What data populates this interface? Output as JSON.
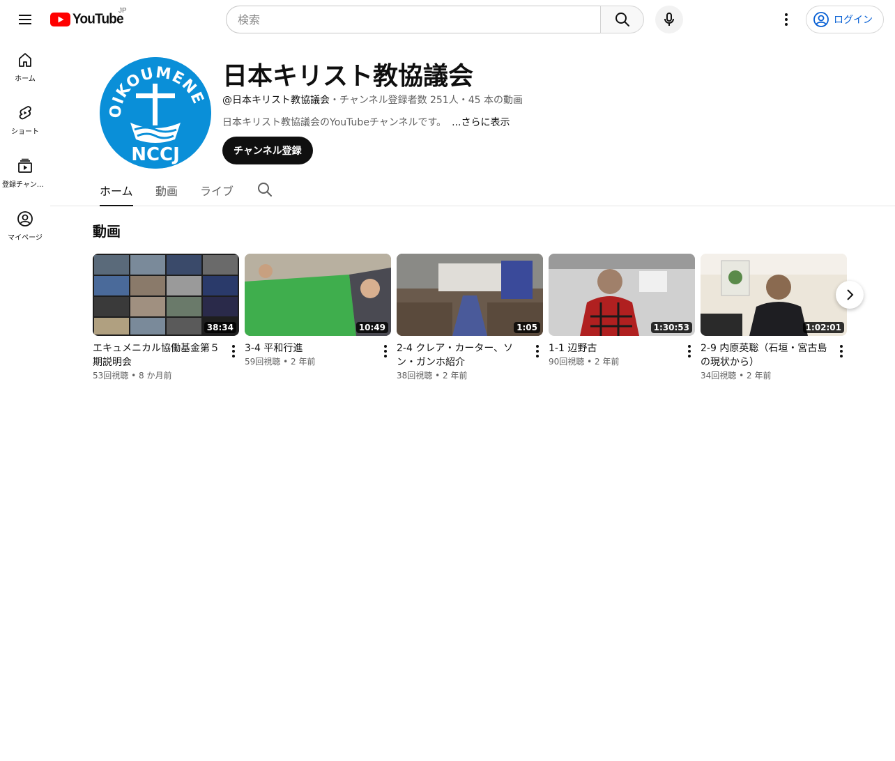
{
  "topbar": {
    "logo_text": "YouTube",
    "country_code": "JP",
    "search_placeholder": "検索",
    "login_label": "ログイン"
  },
  "guide": {
    "items": [
      {
        "label": "ホーム",
        "icon": "home-icon"
      },
      {
        "label": "ショート",
        "icon": "shorts-icon"
      },
      {
        "label": "登録チャンネル",
        "icon": "subscriptions-icon"
      },
      {
        "label": "マイページ",
        "icon": "account-icon"
      }
    ]
  },
  "channel": {
    "avatar_text_top": "OIKOUMENE",
    "avatar_text_bottom": "NCCJ",
    "title": "日本キリスト教協議会",
    "handle": "@日本キリスト教協議会",
    "stats": "・チャンネル登録者数 251人・45 本の動画",
    "description": "日本キリスト教協議会のYouTubeチャンネルです。",
    "more_label": "...さらに表示",
    "subscribe_label": "チャンネル登録"
  },
  "tabs": [
    {
      "label": "ホーム",
      "active": true
    },
    {
      "label": "動画",
      "active": false
    },
    {
      "label": "ライブ",
      "active": false
    }
  ],
  "section": {
    "title": "動画",
    "videos": [
      {
        "title": "エキュメニカル協働基金第５期説明会",
        "duration": "38:34",
        "views": "53回視聴",
        "age": "8 か月前",
        "thumb_colors": [
          "#2b2b2b",
          "#4a5d7a"
        ]
      },
      {
        "title": "3-4 平和行進",
        "duration": "10:49",
        "views": "59回視聴",
        "age": "2 年前",
        "thumb_colors": [
          "#3aa34a",
          "#8a8a7a"
        ]
      },
      {
        "title": "2-4 クレア・カーター、ソン・ガンホ紹介",
        "duration": "1:05",
        "views": "38回視聴",
        "age": "2 年前",
        "thumb_colors": [
          "#6b5a4a",
          "#3f4a7a"
        ]
      },
      {
        "title": "1-1 辺野古",
        "duration": "1:30:53",
        "views": "90回視聴",
        "age": "2 年前",
        "thumb_colors": [
          "#c8c8c8",
          "#b02020"
        ]
      },
      {
        "title": "2-9 内原英聡（石垣・宮古島の現状から）",
        "duration": "1:02:01",
        "views": "34回視聴",
        "age": "2 年前",
        "thumb_colors": [
          "#e8e0d0",
          "#2a2a2a"
        ]
      }
    ]
  },
  "colors": {
    "brand_red": "#ff0000",
    "link_blue": "#065fd4",
    "avatar_blue": "#0a8fd8"
  }
}
